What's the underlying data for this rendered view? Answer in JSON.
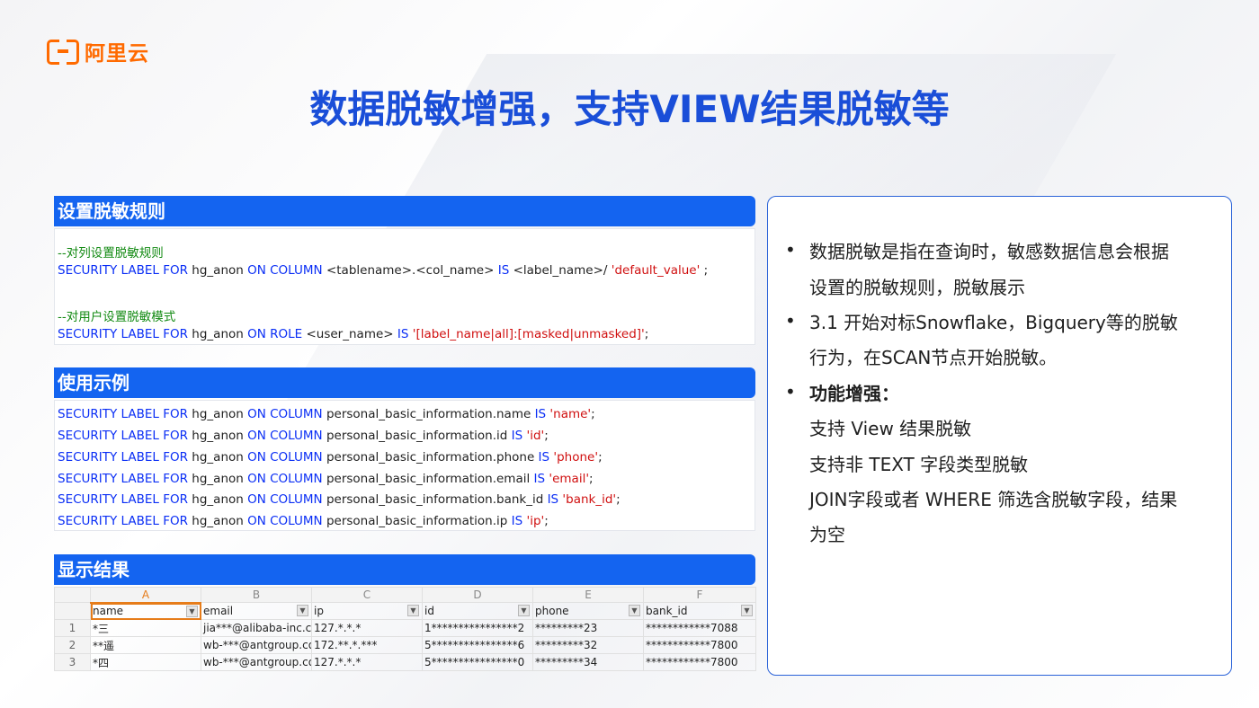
{
  "brand": {
    "logo_text": "阿里云",
    "icon": "aliyun-logo-icon",
    "color": "#ff6a00"
  },
  "title": "数据脱敏增强，支持VIEW结果脱敏等",
  "colors": {
    "title": "#1a4ed8",
    "section_header": "#1464f0",
    "keyword": "#0a2ef5",
    "comment": "#128a12",
    "string": "#d01010",
    "panel_border": "#2a62d8",
    "active_cell": "#e67c1a"
  },
  "rules": {
    "header": "设置脱敏规则",
    "comment1": "--对列设置脱敏规则",
    "line1": {
      "k1": "SECURITY LABEL FOR",
      "t1": " hg_anon ",
      "k2": "ON COLUMN",
      "t2": " <tablename>.<col_name> ",
      "k3": "IS",
      "t3": " <label_name>/ ",
      "s1": "'default_value'",
      "t4": " ;"
    },
    "comment2": "--对用户设置脱敏模式",
    "line2": {
      "k1": "SECURITY LABEL FOR",
      "t1": " hg_anon ",
      "k2": "ON ROLE",
      "t2": " <user_name> ",
      "k3": "IS",
      "s1": " '[label_name|all]:[masked|unmasked]'",
      "t4": ";"
    }
  },
  "example": {
    "header": "使用示例",
    "lines": [
      {
        "k1": "SECURITY LABEL FOR",
        "t1": " hg_anon ",
        "k2": "ON COLUMN",
        "t2": " personal_basic_information.name ",
        "k3": "IS",
        "s1": " 'name'",
        "t3": ";"
      },
      {
        "k1": "SECURITY LABEL FOR",
        "t1": " hg_anon ",
        "k2": "ON COLUMN",
        "t2": " personal_basic_information.id ",
        "k3": "IS",
        "s1": " 'id'",
        "t3": ";"
      },
      {
        "k1": "SECURITY LABEL FOR",
        "t1": " hg_anon ",
        "k2": "ON COLUMN",
        "t2": " personal_basic_information.phone ",
        "k3": "IS",
        "s1": " 'phone'",
        "t3": ";"
      },
      {
        "k1": "SECURITY LABEL FOR",
        "t1": " hg_anon ",
        "k2": "ON COLUMN",
        "t2": " personal_basic_information.email ",
        "k3": "IS",
        "s1": " 'email'",
        "t3": ";"
      },
      {
        "k1": "SECURITY LABEL FOR",
        "t1": " hg_anon ",
        "k2": "ON COLUMN",
        "t2": " personal_basic_information.bank_id ",
        "k3": "IS",
        "s1": " 'bank_id'",
        "t3": ";"
      },
      {
        "k1": "SECURITY LABEL FOR",
        "t1": " hg_anon ",
        "k2": "ON COLUMN",
        "t2": " personal_basic_information.ip ",
        "k3": "IS",
        "s1": " 'ip'",
        "t3": ";"
      }
    ]
  },
  "result": {
    "header": "显示结果",
    "col_letters": [
      "A",
      "B",
      "C",
      "D",
      "E",
      "F"
    ],
    "field_headers": [
      "name",
      "email",
      "ip",
      "id",
      "phone",
      "bank_id"
    ],
    "rows": [
      {
        "num": "1",
        "cells": [
          "*三",
          "jia***@alibaba-inc.cor",
          "127.*.*.*",
          "1****************2",
          "*********23",
          "************7088"
        ]
      },
      {
        "num": "2",
        "cells": [
          "**遥",
          "wb-***@antgroup.cor",
          "172.**.*.***",
          "5****************6",
          "*********32",
          "************7800"
        ]
      },
      {
        "num": "3",
        "cells": [
          "*四",
          "wb-***@antgroup.cor",
          "127.*.*.*",
          "5****************0",
          "*********34",
          "************7800"
        ]
      }
    ]
  },
  "panel": {
    "b1_l1": "数据脱敏是指在查询时，敏感数据信息会根据",
    "b1_l2": "设置的脱敏规则，脱敏展示",
    "b2_l1": "3.1 开始对标Snowflake，Bigquery等的脱敏",
    "b2_l2": "行为，在SCAN节点开始脱敏。",
    "b3_title": "功能增强：",
    "b3_items": [
      "支持 View 结果脱敏",
      "支持非 TEXT 字段类型脱敏",
      "JOIN字段或者 WHERE 筛选含脱敏字段，结果",
      "为空"
    ],
    "bullet": "•"
  }
}
